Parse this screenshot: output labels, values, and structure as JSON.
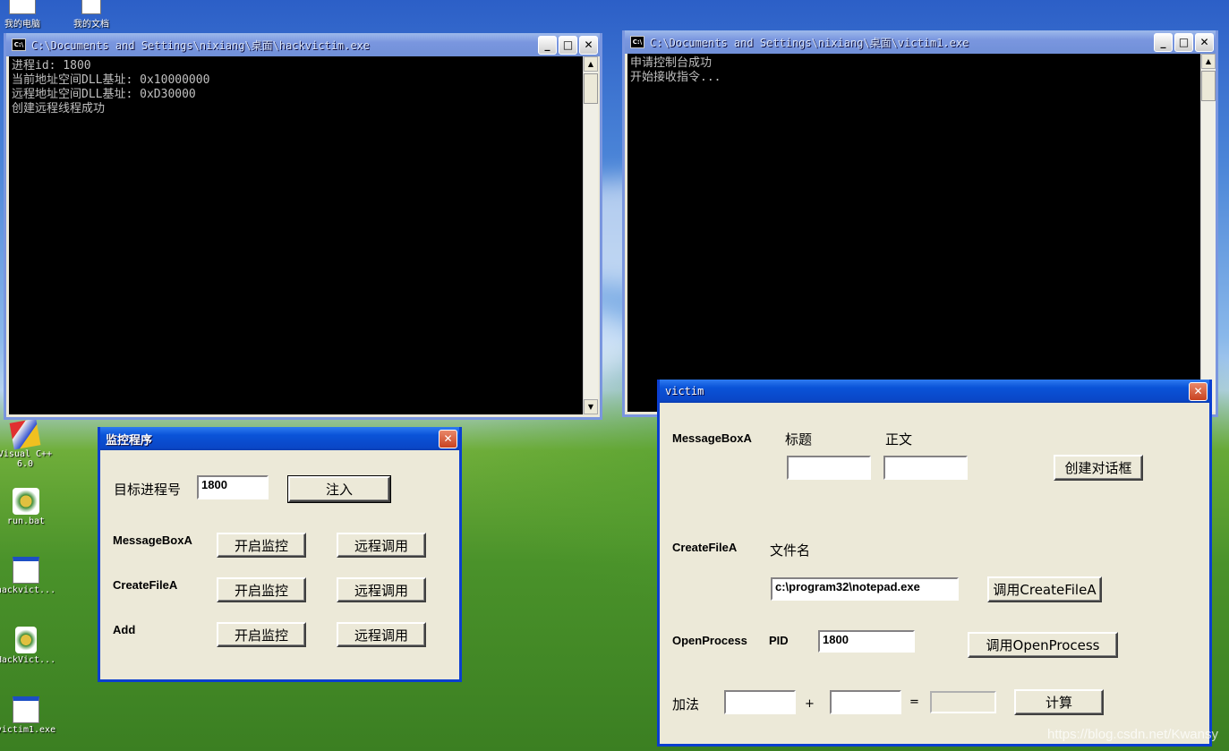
{
  "desktop_icons": [
    {
      "label": "我的电脑"
    },
    {
      "label": "我的文档"
    },
    {
      "label": "Visual C++ 6.0"
    },
    {
      "label": "run.bat"
    },
    {
      "label": "hackvict..."
    },
    {
      "label": "HackVict..."
    },
    {
      "label": "victim1.exe"
    }
  ],
  "console1": {
    "title": "C:\\Documents and Settings\\nixiang\\桌面\\hackvictim.exe",
    "icon": "C:\\",
    "lines": [
      "进程id: 1800",
      "当前地址空间DLL基址: 0x10000000",
      "远程地址空间DLL基址: 0xD30000",
      "创建远程线程成功"
    ]
  },
  "console2": {
    "title": "C:\\Documents and Settings\\nixiang\\桌面\\victim1.exe",
    "icon": "C:\\",
    "lines": [
      "申请控制台成功",
      "开始接收指令..."
    ]
  },
  "monitor": {
    "title": "监控程序",
    "target_label": "目标进程号",
    "target_value": "1800",
    "inject": "注入",
    "rows": [
      {
        "name": "MessageBoxA",
        "monitor": "开启监控",
        "remote": "远程调用"
      },
      {
        "name": "CreateFileA",
        "monitor": "开启监控",
        "remote": "远程调用"
      },
      {
        "name": "Add",
        "monitor": "开启监控",
        "remote": "远程调用"
      }
    ]
  },
  "victim": {
    "title": "victim",
    "msgbox": {
      "name": "MessageBoxA",
      "title_label": "标题",
      "body_label": "正文",
      "title_value": "",
      "body_value": "",
      "button": "创建对话框"
    },
    "createfile": {
      "name": "CreateFileA",
      "file_label": "文件名",
      "file_value": "c:\\program32\\notepad.exe",
      "button": "调用CreateFileA"
    },
    "openprocess": {
      "name": "OpenProcess",
      "pid_label": "PID",
      "pid_value": "1800",
      "button": "调用OpenProcess"
    },
    "add": {
      "name": "加法",
      "plus": "+",
      "eq": "=",
      "a": "",
      "b": "",
      "result": "",
      "button": "计算"
    }
  },
  "watermark": "https://blog.csdn.net/Kwansy",
  "caption_buttons": {
    "min": "_",
    "max": "□",
    "close": "✕"
  }
}
